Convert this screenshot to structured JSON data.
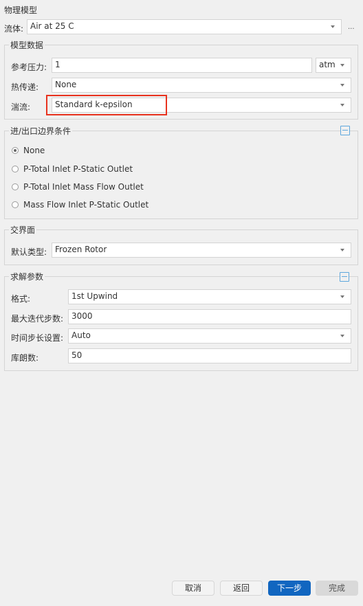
{
  "section_title": "物理模型",
  "fluid": {
    "label": "流体:",
    "value": "Air at 25 C",
    "browse_label": "..."
  },
  "model_data": {
    "title": "模型数据",
    "reference_pressure": {
      "label": "参考压力:",
      "value": "1",
      "unit": "atm"
    },
    "heat_transfer": {
      "label": "热传递:",
      "value": "None"
    },
    "turbulence": {
      "label": "湍流:",
      "value": "Standard k-epsilon"
    }
  },
  "boundary": {
    "title": "进/出口边界条件",
    "options": [
      {
        "label": "None",
        "checked": true
      },
      {
        "label": "P-Total Inlet P-Static Outlet",
        "checked": false
      },
      {
        "label": "P-Total Inlet Mass Flow Outlet",
        "checked": false
      },
      {
        "label": "Mass Flow Inlet P-Static Outlet",
        "checked": false
      }
    ]
  },
  "interface": {
    "title": "交界面",
    "default_type": {
      "label": "默认类型:",
      "value": "Frozen Rotor"
    }
  },
  "solver": {
    "title": "求解参数",
    "scheme": {
      "label": "格式:",
      "value": "1st Upwind"
    },
    "max_iterations": {
      "label": "最大迭代步数:",
      "value": "3000"
    },
    "timestep": {
      "label": "时间步长设置:",
      "value": "Auto"
    },
    "courant": {
      "label": "库朗数:",
      "value": "50"
    }
  },
  "footer": {
    "cancel": "取消",
    "back": "返回",
    "next": "下一步",
    "finish": "完成"
  },
  "colors": {
    "accent": "#1166c0",
    "highlight": "#e8321e",
    "collapse_icon": "#5ea7dd"
  }
}
